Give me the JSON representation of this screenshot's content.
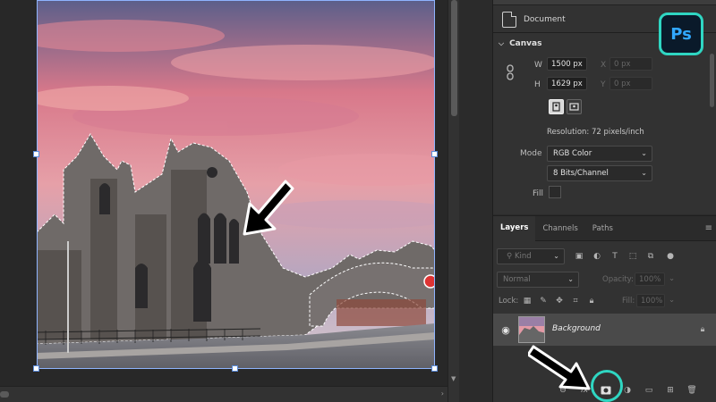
{
  "properties": {
    "document_label": "Document",
    "canvas_section": "Canvas",
    "width_label": "W",
    "width_value": "1500 px",
    "height_label": "H",
    "height_value": "1629 px",
    "x_label": "X",
    "x_value": "0 px",
    "y_label": "Y",
    "y_value": "0 px",
    "resolution": "Resolution: 72 pixels/inch",
    "mode_label": "Mode",
    "mode_value": "RGB Color",
    "bits_value": "8 Bits/Channel",
    "fill_label": "Fill"
  },
  "badge": {
    "text": "Ps",
    "border_color": "#2fd6c2"
  },
  "layers_panel": {
    "tabs": [
      "Layers",
      "Channels",
      "Paths"
    ],
    "kind_label": "Kind",
    "blend_mode": "Normal",
    "opacity_label": "Opacity:",
    "opacity_value": "100%",
    "lock_label": "Lock:",
    "fill_label": "Fill:",
    "fill_value": "100%",
    "layer_name": "Background",
    "bottom_icons": [
      "link-icon",
      "fx-icon",
      "add-mask-icon",
      "adjustment-icon",
      "folder-icon",
      "new-layer-icon",
      "trash-icon"
    ]
  },
  "annotations": {
    "highlight_color": "#2fd6c2",
    "arrow_color": "#000000"
  }
}
